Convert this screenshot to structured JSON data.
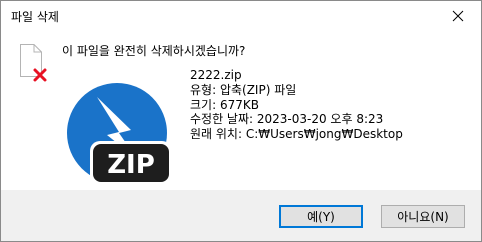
{
  "window": {
    "title": "파일 삭제"
  },
  "message": "이 파일을 완전히 삭제하시겠습니까?",
  "file": {
    "name": "2222.zip",
    "type": "유형: 압축(ZIP) 파일",
    "size": "크기: 677KB",
    "modified": "수정한 날짜: 2023-03-20 오후 8:23",
    "location": "원래 위치: C:₩Users₩jong₩Desktop",
    "badge": "ZIP"
  },
  "buttons": {
    "yes_text": "예",
    "yes_key": "(Y)",
    "no_text": "아니요",
    "no_key": "(N)"
  },
  "icons": [
    "delete-document-icon",
    "zip-file-icon",
    "close-icon"
  ],
  "colors": {
    "accent": "#0078d7",
    "zip_blue": "#1a73c9",
    "delete_red": "#e81123"
  }
}
